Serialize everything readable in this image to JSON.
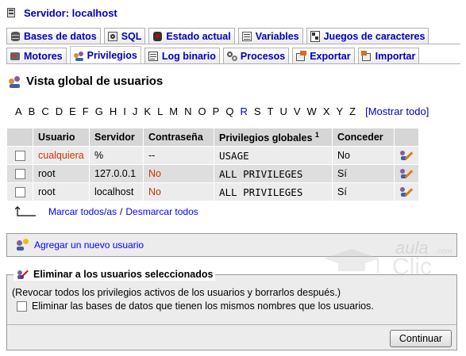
{
  "server": {
    "label": "Servidor: localhost"
  },
  "tabs_row1": [
    {
      "label": "Bases de datos",
      "icon": "database-icon"
    },
    {
      "label": "SQL",
      "icon": "sql-icon"
    },
    {
      "label": "Estado actual",
      "icon": "status-icon"
    },
    {
      "label": "Variables",
      "icon": "variables-icon"
    },
    {
      "label": "Juegos de caracteres",
      "icon": "charset-icon"
    }
  ],
  "tabs_row2": [
    {
      "label": "Motores",
      "icon": "engines-icon",
      "active": false
    },
    {
      "label": "Privilegios",
      "icon": "privileges-icon",
      "active": true
    },
    {
      "label": "Log binario",
      "icon": "binlog-icon",
      "active": false
    },
    {
      "label": "Procesos",
      "icon": "processes-icon",
      "active": false
    },
    {
      "label": "Exportar",
      "icon": "export-icon",
      "active": false
    },
    {
      "label": "Importar",
      "icon": "import-icon",
      "active": false
    }
  ],
  "heading": "Vista global de usuarios",
  "alphabet": [
    "A",
    "B",
    "C",
    "D",
    "E",
    "F",
    "G",
    "H",
    "I",
    "J",
    "K",
    "L",
    "M",
    "N",
    "O",
    "P",
    "Q",
    "R",
    "S",
    "T",
    "U",
    "V",
    "W",
    "X",
    "Y",
    "Z"
  ],
  "alphabet_current": "R",
  "show_all": "[Mostrar todo]",
  "table": {
    "headers": [
      "Usuario",
      "Servidor",
      "Contraseña",
      "Privilegios globales",
      "Conceder"
    ],
    "footnote_mark": "1",
    "rows": [
      {
        "user": "cualquiera",
        "host": "%",
        "password": "--",
        "privileges": "USAGE",
        "grant": "No"
      },
      {
        "user": "root",
        "host": "127.0.0.1",
        "password": "No",
        "privileges": "ALL PRIVILEGES",
        "grant": "Sí"
      },
      {
        "user": "root",
        "host": "localhost",
        "password": "No",
        "privileges": "ALL PRIVILEGES",
        "grant": "Sí"
      }
    ]
  },
  "mark_all": "Marcar todos/as",
  "mark_sep": "/",
  "unmark_all": "Desmarcar todos",
  "add_user": "Agregar un nuevo usuario",
  "delete_section": {
    "legend": "Eliminar a los usuarios seleccionados",
    "note": "(Revocar todos los privilegios activos de los usuarios y borrarlos después.)",
    "option": "Eliminar las bases de datos que tienen los mismos nombres que los usuarios.",
    "button": "Continuar"
  },
  "watermark": {
    "line1": "aula",
    "line2": "Clic",
    "suffix": ".com"
  },
  "colors": {
    "link": "#0000bb",
    "red_text": "#cc3300",
    "header_bg": "#d6d6d6",
    "row_bg": "#ececec"
  }
}
